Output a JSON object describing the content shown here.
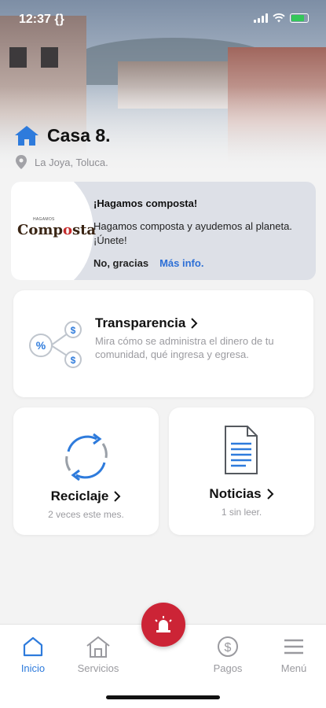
{
  "status_bar": {
    "time": "12:37",
    "sync_glyph": "{}"
  },
  "header": {
    "house_name": "Casa 8.",
    "location": "La Joya, Toluca."
  },
  "promo": {
    "logo_small": "HAGAMOS",
    "logo_text_1": "C",
    "logo_text_2": "omp",
    "logo_text_3": "o",
    "logo_text_4": "sta",
    "title": "¡Hagamos composta!",
    "body": "Hagamos composta y ayudemos al planeta. ¡Únete!",
    "decline": "No, gracias",
    "more": "Más info."
  },
  "transparency": {
    "title": "Transparencia",
    "description": "Mira cómo se administra el dinero de tu comunidad, qué ingresa y egresa."
  },
  "recycling": {
    "title": "Reciclaje",
    "subtitle": "2 veces este mes."
  },
  "news": {
    "title": "Noticias",
    "subtitle": "1 sin leer."
  },
  "tabs": {
    "inicio": "Inicio",
    "servicios": "Servicios",
    "pagos": "Pagos",
    "menu": "Menú"
  },
  "colors": {
    "accent": "#2e7bdc",
    "alarm": "#cc2436",
    "promo_bg": "#dde0e7"
  }
}
